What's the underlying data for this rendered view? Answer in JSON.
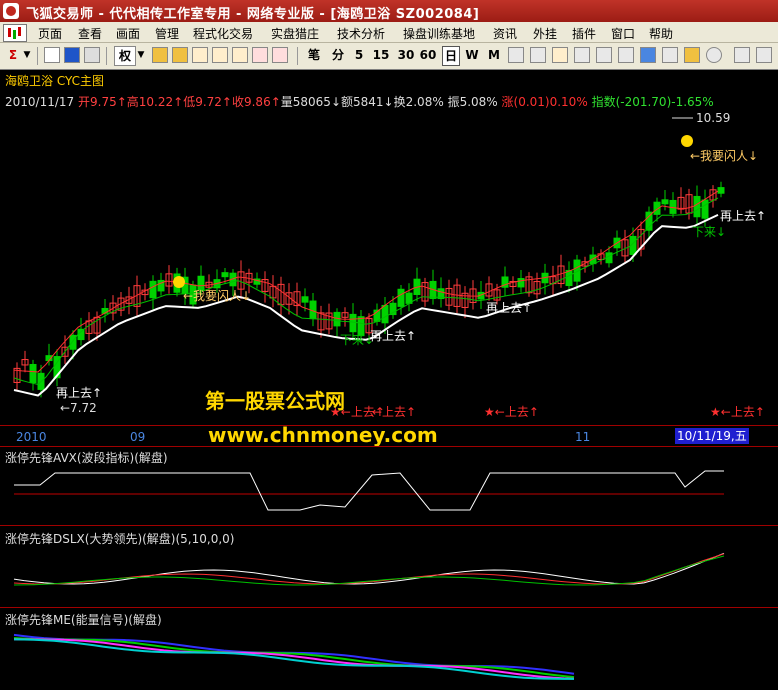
{
  "titlebar": {
    "text": "飞狐交易师 - 代代相传工作室专用 - 网络专业版 - [海鸥卫浴 SZ002084]"
  },
  "menu": [
    "页面",
    "查看",
    "画面",
    "管理",
    "程式化交易",
    "实盘猎庄",
    "技术分析",
    "操盘训练基地",
    "资讯",
    "外挂",
    "插件",
    "窗口",
    "帮助"
  ],
  "toolbar": {
    "sigma": "Σ",
    "quan": "权",
    "bi": "笔",
    "fen": "分",
    "periods": [
      "5",
      "15",
      "30",
      "60"
    ],
    "day": "日",
    "week": "W",
    "month": "M"
  },
  "main_chart": {
    "title": "海鸥卫浴 CYC主图",
    "date": "2010/11/17",
    "open": "开9.75↑",
    "high": "高10.22↑",
    "low": "低9.72↑",
    "close": "收9.86↑",
    "volume": "量58065↓",
    "amount": "额5841↓",
    "turnover": "换2.08%",
    "amplitude": "振5.08%",
    "change": "涨(0.01)0.10%",
    "index": "指数(-201.70)-1.65%",
    "high_label": "10.59",
    "low_label": "7.72",
    "labels": {
      "lift": "再上去↑",
      "run": "←我要闪人↓",
      "down": "下来↓",
      "star_up": "←上去↑"
    },
    "colors": {
      "up": "#ff3c3c",
      "down": "#00d200",
      "ma": "#ffffff"
    }
  },
  "watermark": {
    "line1": "第一股票公式网",
    "line2": "www.chnmoney.com"
  },
  "x_axis": {
    "labels": [
      "2010",
      "09",
      "11"
    ],
    "current": "10/11/19,五"
  },
  "panels": {
    "avx": {
      "title": "涨停先锋AVX(波段指标)(解盘)"
    },
    "dslx": {
      "title": "涨停先锋DSLX(大势领先)(解盘)(5,10,0,0)"
    },
    "me": {
      "title": "涨停先锋ME(能量信号)(解盘)"
    }
  }
}
